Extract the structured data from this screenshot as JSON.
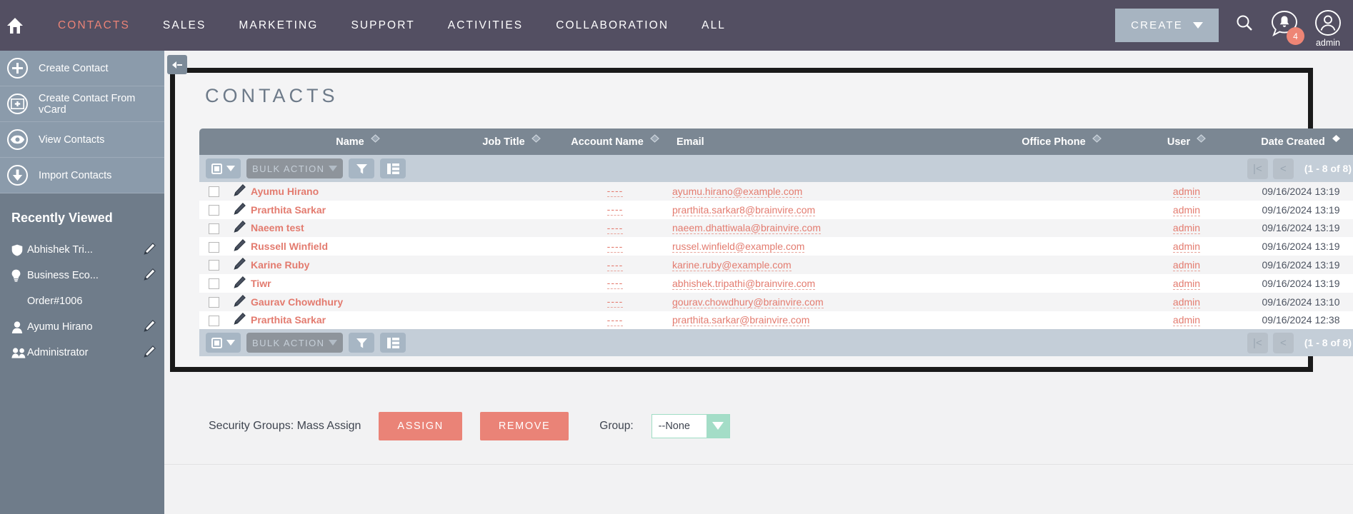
{
  "topnav": {
    "home_icon": "home-icon",
    "items": [
      {
        "label": "CONTACTS",
        "active": true
      },
      {
        "label": "SALES",
        "active": false
      },
      {
        "label": "MARKETING",
        "active": false
      },
      {
        "label": "SUPPORT",
        "active": false
      },
      {
        "label": "ACTIVITIES",
        "active": false
      },
      {
        "label": "COLLABORATION",
        "active": false
      },
      {
        "label": "ALL",
        "active": false
      }
    ],
    "create_label": "CREATE",
    "search_icon": "search-icon",
    "notification_icon": "notification-bell-icon",
    "notification_count": "4",
    "user_icon": "user-avatar-icon",
    "user_name": "admin",
    "accent_color": "#ea8377",
    "background_color": "#534f62"
  },
  "sidebar": {
    "actions": [
      {
        "label": "Create Contact",
        "icon": "plus-circle-icon"
      },
      {
        "label": "Create Contact From vCard",
        "icon": "card-plus-icon"
      },
      {
        "label": "View Contacts",
        "icon": "eye-icon"
      },
      {
        "label": "Import Contacts",
        "icon": "download-arrow-icon"
      }
    ],
    "recent_title": "Recently Viewed",
    "recent_items": [
      {
        "label": "Abhishek Tri...",
        "icon": "shield-icon",
        "editable": true
      },
      {
        "label": "Business Eco...",
        "icon": "lightbulb-icon",
        "editable": true
      },
      {
        "label": "Order#1006",
        "icon": "none",
        "editable": false
      },
      {
        "label": "Ayumu Hirano",
        "icon": "person-icon",
        "editable": true
      },
      {
        "label": "Administrator",
        "icon": "people-icon",
        "editable": true
      }
    ]
  },
  "panel": {
    "title": "CONTACTS",
    "collapse_icon": "collapse-left-icon"
  },
  "table": {
    "columns": [
      {
        "label": "",
        "key": "check"
      },
      {
        "label": "",
        "key": "pencil"
      },
      {
        "label": "Name",
        "key": "name",
        "sort": "none"
      },
      {
        "label": "Job Title",
        "key": "job",
        "sort": "none"
      },
      {
        "label": "Account Name",
        "key": "account",
        "sort": "none"
      },
      {
        "label": "Email",
        "key": "email",
        "sort": "hidden"
      },
      {
        "label": "Office Phone",
        "key": "phone",
        "sort": "none"
      },
      {
        "label": "User",
        "key": "user",
        "sort": "none"
      },
      {
        "label": "Date Created",
        "key": "date",
        "sort": "desc"
      },
      {
        "label": "",
        "key": "info"
      }
    ],
    "toolbar": {
      "select_all_icon": "checkbox-dropdown-icon",
      "bulk_action_label": "BULK ACTION",
      "filter_icon": "funnel-icon",
      "columns_icon": "column-chooser-icon"
    },
    "pagination": {
      "first_icon": "page-first-icon",
      "prev_icon": "page-prev-icon",
      "label": "(1 - 8 of 8)",
      "next_icon": "page-next-icon",
      "last_icon": "page-last-icon"
    },
    "rows": [
      {
        "name": "Ayumu Hirano",
        "job": "",
        "account": "----",
        "email": "ayumu.hirano@example.com",
        "phone": "",
        "user": "admin",
        "date": "09/16/2024 13:19"
      },
      {
        "name": "Prarthita Sarkar",
        "job": "",
        "account": "----",
        "email": "prarthita.sarkar8@brainvire.com",
        "phone": "",
        "user": "admin",
        "date": "09/16/2024 13:19"
      },
      {
        "name": "Naeem test",
        "job": "",
        "account": "----",
        "email": "naeem.dhattiwala@brainvire.com",
        "phone": "",
        "user": "admin",
        "date": "09/16/2024 13:19"
      },
      {
        "name": "Russell Winfield",
        "job": "",
        "account": "----",
        "email": "russel.winfield@example.com",
        "phone": "",
        "user": "admin",
        "date": "09/16/2024 13:19"
      },
      {
        "name": "Karine Ruby",
        "job": "",
        "account": "----",
        "email": "karine.ruby@example.com",
        "phone": "",
        "user": "admin",
        "date": "09/16/2024 13:19"
      },
      {
        "name": "Tiwr",
        "job": "",
        "account": "----",
        "email": "abhishek.tripathi@brainvire.com",
        "phone": "",
        "user": "admin",
        "date": "09/16/2024 13:19"
      },
      {
        "name": "Gaurav Chowdhury",
        "job": "",
        "account": "----",
        "email": "gourav.chowdhury@brainvire.com",
        "phone": "",
        "user": "admin",
        "date": "09/16/2024 13:10"
      },
      {
        "name": "Prarthita Sarkar",
        "job": "",
        "account": "----",
        "email": "prarthita.sarkar@brainvire.com",
        "phone": "",
        "user": "admin",
        "date": "09/16/2024 12:38"
      }
    ]
  },
  "security": {
    "label": "Security Groups: Mass Assign",
    "assign_label": "ASSIGN",
    "remove_label": "REMOVE",
    "group_label": "Group:",
    "group_value": "--None",
    "group_options": [
      "--None"
    ],
    "button_color": "#ea8377"
  }
}
